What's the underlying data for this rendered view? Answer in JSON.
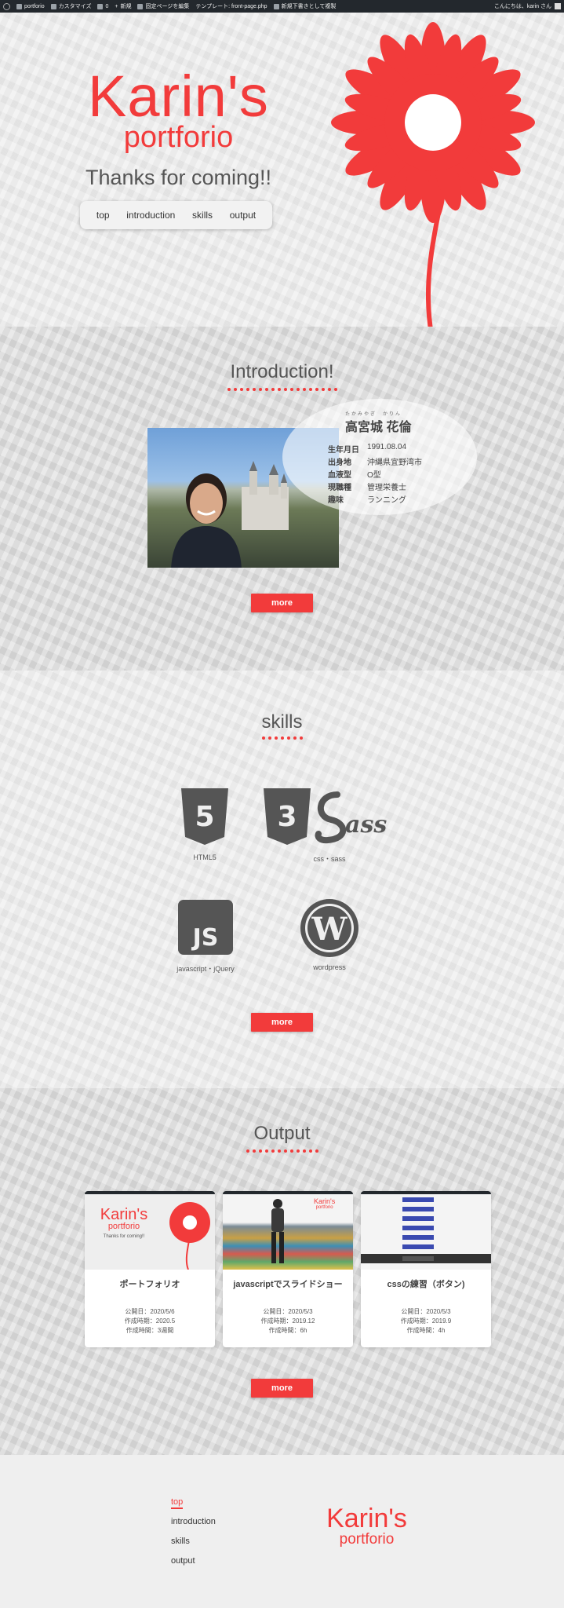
{
  "adminbar": {
    "site": "portforio",
    "customize": "カスタマイズ",
    "comments": "0",
    "new": "新規",
    "edit_page": "固定ページを編集",
    "template": "テンプレート: front-page.php",
    "duplicate": "新規下書きとして複製",
    "greeting": "こんにちは、karin さん"
  },
  "hero": {
    "title_line1": "Karin's",
    "title_line2": "portforio",
    "subtitle": "Thanks for coming!!",
    "nav": [
      "top",
      "introduction",
      "skills",
      "output"
    ]
  },
  "intro": {
    "heading": "Introduction!",
    "ruby": "たかみやぎ　かりん",
    "name": "高宮城 花倫",
    "profile": [
      {
        "key": "生年月日",
        "value": "1991.08.04"
      },
      {
        "key": "出身地",
        "value": "沖縄県宜野湾市"
      },
      {
        "key": "血液型",
        "value": "O型"
      },
      {
        "key": "現職種",
        "value": "管理栄養士"
      },
      {
        "key": "趣味",
        "value": "ランニング"
      }
    ],
    "more": "more"
  },
  "skills": {
    "heading": "skills",
    "items": [
      {
        "label": "HTML5"
      },
      {
        "label": "css・sass"
      },
      {
        "label": "javascript・jQuery"
      },
      {
        "label": "wordpress"
      }
    ],
    "more": "more"
  },
  "output": {
    "heading": "Output",
    "cards": [
      {
        "title": "ポートフォリオ",
        "published": "公開日：2020/5/6",
        "created": "作成時期：2020.5",
        "duration": "作成時間：3週間"
      },
      {
        "title": "javascriptでスライドショー",
        "published": "公開日：2020/5/3",
        "created": "作成時期：2019.12",
        "duration": "作成時間：6h"
      },
      {
        "title": "cssの練習（ボタン)",
        "published": "公開日：2020/5/3",
        "created": "作成時期：2019.9",
        "duration": "作成時間：4h"
      }
    ],
    "more": "more",
    "thumb1": {
      "title1": "Karin's",
      "title2": "portforio",
      "sub": "Thanks for coming!!"
    },
    "thumb2": {
      "title1": "Karin's",
      "title2": "portforio"
    }
  },
  "footer": {
    "nav": [
      "top",
      "introduction",
      "skills",
      "output"
    ],
    "logo_line1": "Karin's",
    "logo_line2": "portforio"
  },
  "colors": {
    "accent": "#f23b3b",
    "adminbar": "#23282d"
  }
}
